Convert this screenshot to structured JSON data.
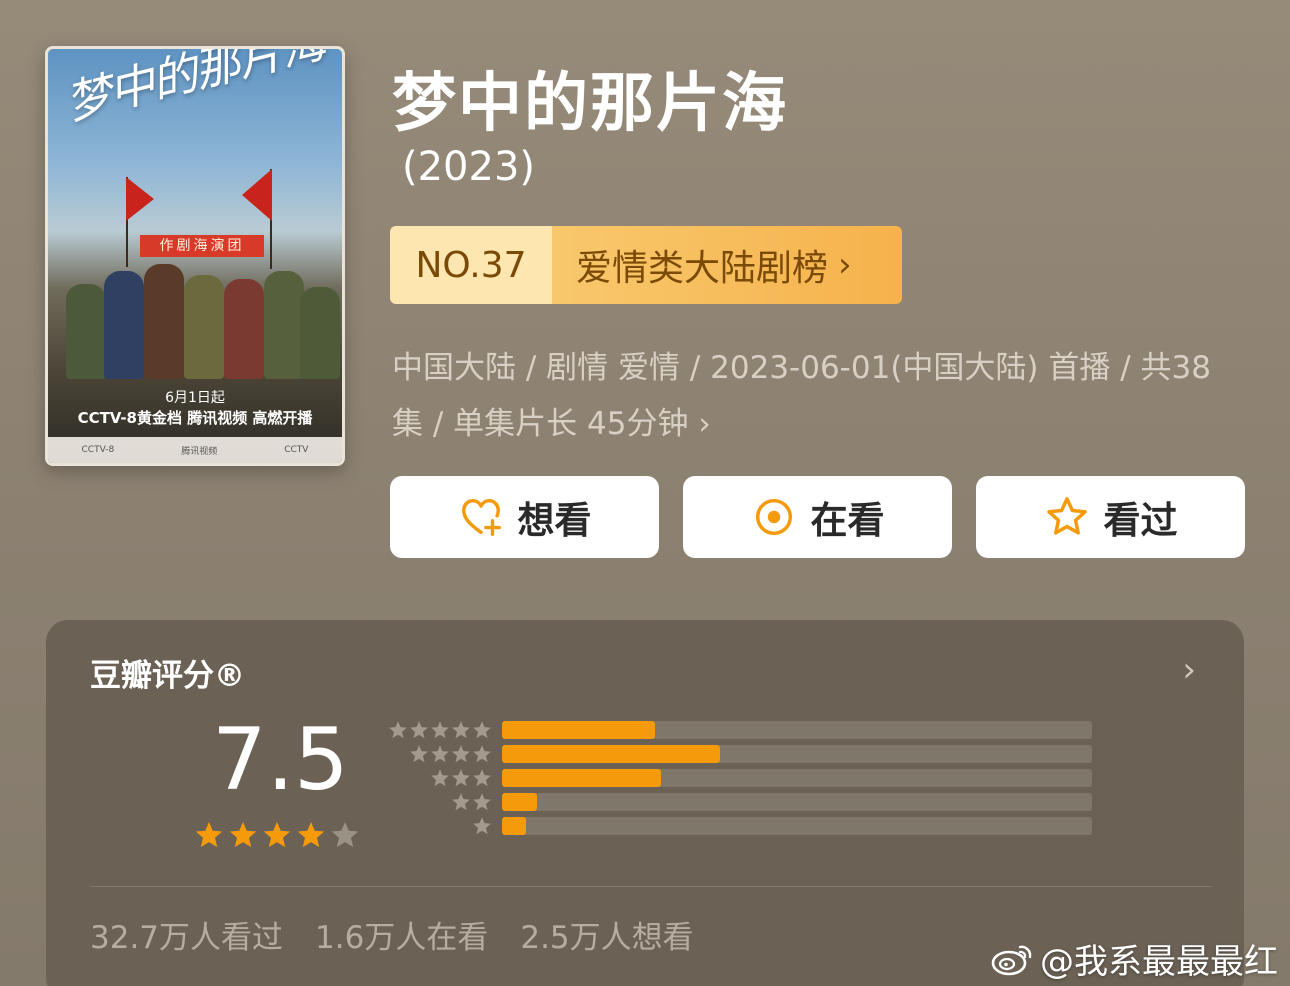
{
  "poster": {
    "title": "梦中的那片海",
    "banner": "作剧海演团",
    "caption_line1": "6月1日起",
    "caption_line2": "CCTV-8黄金档 腾讯视频 高燃开播",
    "footer_left": "CCTV-8",
    "footer_mid": "腾讯视频",
    "footer_right": "CCTV"
  },
  "show": {
    "title": "梦中的那片海",
    "year": "(2023)"
  },
  "rank": {
    "number": "NO.37",
    "list_name": "爱情类大陆剧榜",
    "chevron": "›"
  },
  "meta": {
    "line": "中国大陆 / 剧情 爱情 / 2023-06-01(中国大陆) 首播 / 共38集 / 单集片长 45分钟",
    "chevron": "›"
  },
  "actions": {
    "want": {
      "label": "想看",
      "icon": "heart-plus-icon"
    },
    "watching": {
      "label": "在看",
      "icon": "circle-dot-icon"
    },
    "watched": {
      "label": "看过",
      "icon": "star-outline-icon"
    }
  },
  "rating": {
    "label": "豆瓣评分®",
    "chevron": "›",
    "score": "7.5",
    "stars_filled": 4,
    "stars_total": 5,
    "distribution": [
      {
        "stars": 5,
        "fraction": 0.26
      },
      {
        "stars": 4,
        "fraction": 0.37
      },
      {
        "stars": 3,
        "fraction": 0.27
      },
      {
        "stars": 2,
        "fraction": 0.06
      },
      {
        "stars": 1,
        "fraction": 0.04
      }
    ],
    "stats": {
      "watched": "32.7万人看过",
      "watching": "1.6万人在看",
      "want": "2.5万人想看"
    }
  },
  "watermark": {
    "text": "@我系最最最红",
    "icon": "weibo-icon"
  },
  "colors": {
    "accent_orange": "#f59a0a",
    "rank_number_bg": "#fde6b0",
    "rank_list_bg": "#f6b24c",
    "card_bg": "#6b6155",
    "page_bg": "#8d8272"
  }
}
